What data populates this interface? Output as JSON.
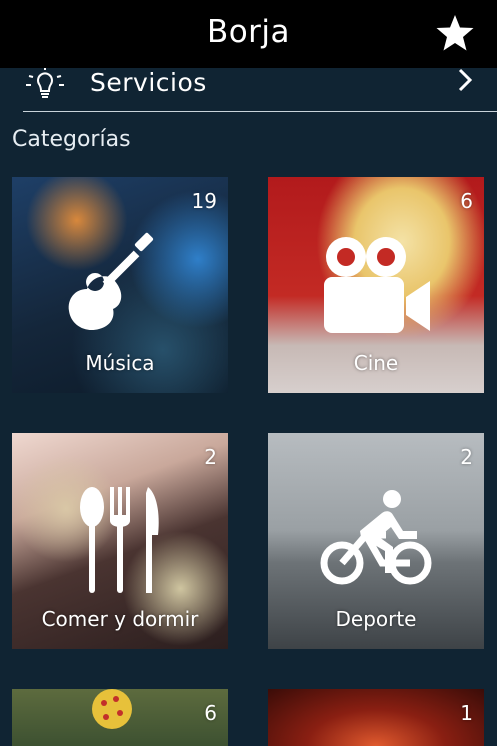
{
  "header": {
    "title": "Borja",
    "favorite_icon": "star-icon"
  },
  "services": {
    "label": "Servicios",
    "icon": "lightbulb-icon",
    "chevron": "chevron-right-icon"
  },
  "categories": {
    "title": "Categorías",
    "items": [
      {
        "name": "Música",
        "count": "19",
        "icon": "guitar-icon"
      },
      {
        "name": "Cine",
        "count": "6",
        "icon": "video-camera-icon"
      },
      {
        "name": "Comer y dormir",
        "count": "2",
        "icon": "utensils-icon"
      },
      {
        "name": "Deporte",
        "count": "2",
        "icon": "bicycle-icon"
      },
      {
        "name": "",
        "count": "6",
        "icon": ""
      },
      {
        "name": "",
        "count": "1",
        "icon": ""
      }
    ]
  }
}
